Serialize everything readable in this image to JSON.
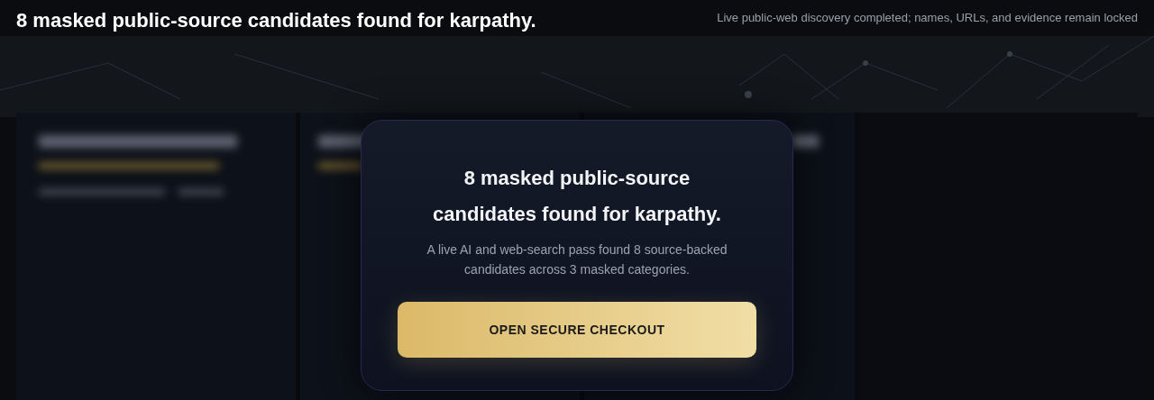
{
  "header": {
    "title": "8 masked public-source candidates found for karpathy.",
    "status": "Live public-web discovery completed; names, URLs, and evidence remain locked"
  },
  "dialog": {
    "title": "8 masked public-source candidates found for karpathy.",
    "description": "A live AI and web-search pass found 8 source-backed candidates across 3 masked categories.",
    "button": "OPEN SECURE CHECKOUT"
  }
}
